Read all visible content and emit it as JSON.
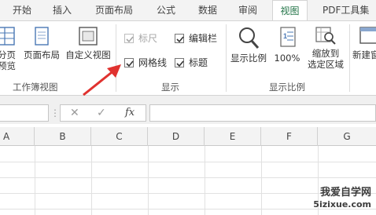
{
  "tabs": [
    "开始",
    "插入",
    "页面布局",
    "公式",
    "数据",
    "审阅",
    "视图",
    "PDF工具集"
  ],
  "active_tab": "视图",
  "ribbon": {
    "workbook_views": {
      "label": "工作簿视图",
      "page_break_line1": "分页",
      "page_break_line2": "预览",
      "page_layout": "页面布局",
      "custom_view": "自定义视图"
    },
    "show": {
      "label": "显示",
      "ruler": {
        "label": "标尺",
        "checked": true,
        "disabled": true
      },
      "formula_bar": {
        "label": "编辑栏",
        "checked": true
      },
      "gridlines": {
        "label": "网格线",
        "checked": true
      },
      "headings": {
        "label": "标题",
        "checked": true
      }
    },
    "zoom": {
      "label": "显示比例",
      "zoom": "显示比例",
      "hundred": "100%",
      "zoom_to_selection_line1": "缩放到",
      "zoom_to_selection_line2": "选定区域"
    },
    "window": {
      "new_window": "新建窗"
    }
  },
  "formula_bar": {
    "cancel": "✕",
    "enter": "✓",
    "fx": "fx"
  },
  "columns": [
    "A",
    "B",
    "C",
    "D",
    "E",
    "F",
    "G"
  ],
  "watermark": {
    "line1": "我爱自学网",
    "line2": "5izixue.com"
  },
  "colors": {
    "accent": "#217346",
    "arrow": "#e0322f"
  }
}
